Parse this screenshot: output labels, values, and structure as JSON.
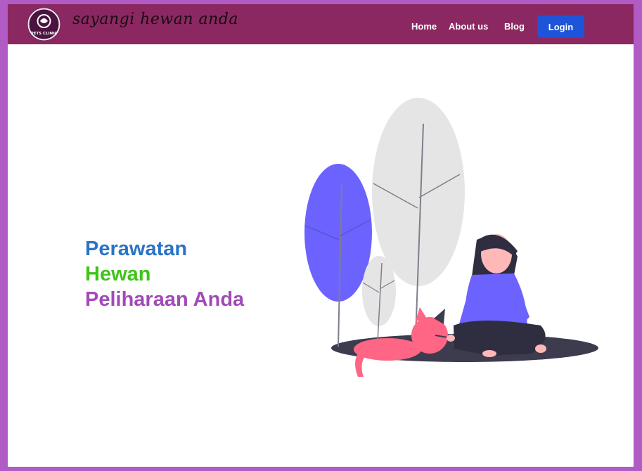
{
  "app": {
    "logo_text": "PETS CLINIC",
    "tagline": "sayangi hewan anda"
  },
  "nav": {
    "home": "Home",
    "about": "About us",
    "blog": "Blog",
    "login": "Login"
  },
  "hero": {
    "line1": "Perawatan",
    "line2": "Hewan",
    "line3": "Peliharaan Anda"
  },
  "colors": {
    "frame": "#b15bc5",
    "navbar": "#8b2861",
    "login_button": "#1e54d9",
    "line1": "#2a73c6",
    "line2": "#3ec41a",
    "line3": "#a24ab8"
  },
  "illustration": "woman-with-cat-and-trees"
}
